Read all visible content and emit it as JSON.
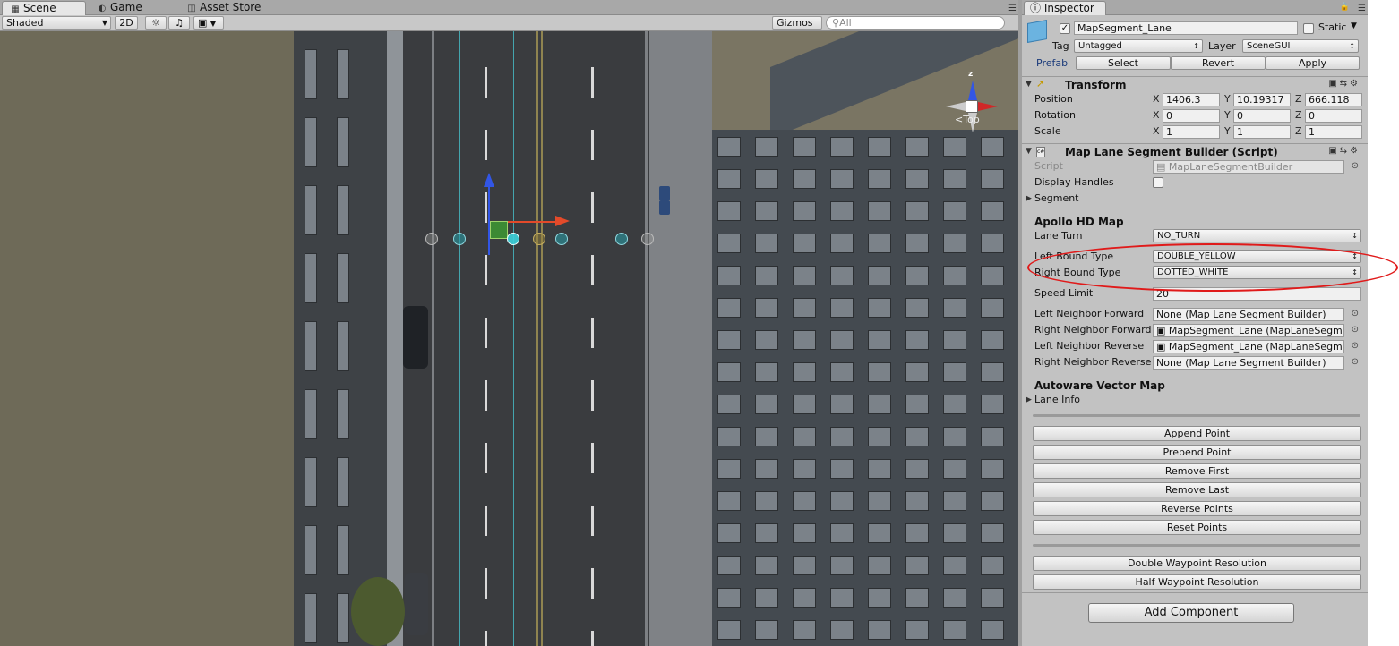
{
  "scene": {
    "tabs": [
      {
        "label": "Scene",
        "icon": "scene-icon"
      },
      {
        "label": "Game",
        "icon": "game-icon"
      },
      {
        "label": "Asset Store",
        "icon": "asset-store-icon"
      }
    ],
    "toolbar": {
      "shading": "Shaded",
      "mode_2d": "2D",
      "gizmos": "Gizmos",
      "search_placeholder": "All"
    },
    "orientation": {
      "axis_z": "z",
      "view": "Top"
    }
  },
  "inspector": {
    "tab": "Inspector",
    "object": {
      "active": true,
      "name": "MapSegment_Lane",
      "static_label": "Static",
      "tag_label": "Tag",
      "tag_value": "Untagged",
      "layer_label": "Layer",
      "layer_value": "SceneGUI",
      "prefab_label": "Prefab",
      "prefab_buttons": [
        "Select",
        "Revert",
        "Apply"
      ]
    },
    "transform": {
      "title": "Transform",
      "position": {
        "label": "Position",
        "x": "1406.3",
        "y": "10.19317",
        "z": "666.118"
      },
      "rotation": {
        "label": "Rotation",
        "x": "0",
        "y": "0",
        "z": "0"
      },
      "scale": {
        "label": "Scale",
        "x": "1",
        "y": "1",
        "z": "1"
      }
    },
    "script_component": {
      "title": "Map Lane Segment Builder (Script)",
      "script_label": "Script",
      "script_value": "MapLaneSegmentBuilder",
      "display_handles_label": "Display Handles",
      "segment_label": "Segment",
      "apollo_title": "Apollo HD Map",
      "lane_turn_label": "Lane Turn",
      "lane_turn_value": "NO_TURN",
      "left_bound_label": "Left Bound Type",
      "left_bound_value": "DOUBLE_YELLOW",
      "right_bound_label": "Right Bound Type",
      "right_bound_value": "DOTTED_WHITE",
      "speed_limit_label": "Speed Limit",
      "speed_limit_value": "20",
      "neighbors": [
        {
          "label": "Left Neighbor Forward",
          "value": "None (Map Lane Segment Builder)"
        },
        {
          "label": "Right Neighbor Forward",
          "value": "MapSegment_Lane (MapLaneSegm"
        },
        {
          "label": "Left Neighbor Reverse",
          "value": "MapSegment_Lane (MapLaneSegm"
        },
        {
          "label": "Right Neighbor Reverse",
          "value": "None (Map Lane Segment Builder)"
        }
      ],
      "autoware_title": "Autoware Vector Map",
      "lane_info_label": "Lane Info",
      "buttons": [
        "Append Point",
        "Prepend Point",
        "Remove First",
        "Remove Last",
        "Reverse Points",
        "Reset Points"
      ],
      "resolution_buttons": [
        "Double Waypoint Resolution",
        "Half Waypoint Resolution"
      ]
    },
    "add_component": "Add Component"
  },
  "colors": {
    "highlight": "#e01a1a",
    "axis_x": "#e34a2a",
    "axis_y": "#3256e6",
    "lane_line": "#46b7c2"
  }
}
